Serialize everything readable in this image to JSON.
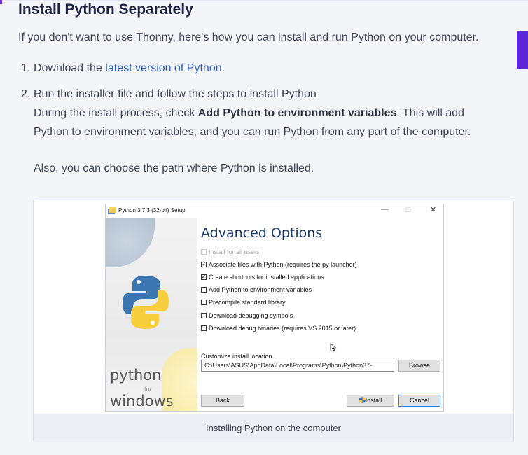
{
  "heading": "Install Python Separately",
  "intro": "If you don't want to use Thonny, here's how you can install and run Python on your computer.",
  "steps": [
    {
      "num": "1.",
      "prefix": "Download the ",
      "link": "latest version of Python",
      "suffix": "."
    },
    {
      "num": "2.",
      "line1": "Run the installer file and follow the steps to install Python",
      "line2_pre": "During the install process, check ",
      "line2_bold": "Add Python to environment variables",
      "line2_post": ". This will add",
      "line3": "Python to environment variables, and you can run Python from any part of the computer."
    }
  ],
  "also": "Also, you can choose the path where Python is installed.",
  "figure": {
    "caption": "Installing Python on the computer",
    "window": {
      "title": "Python 3.7.3 (32-bit) Setup",
      "minimize": "—",
      "maximize": "☐",
      "close": "✕",
      "heading": "Advanced Options",
      "brand_python": "python",
      "brand_for": "for",
      "brand_windows": "windows",
      "options": [
        {
          "label": "Install for all users",
          "checked": false,
          "disabled": true
        },
        {
          "label": "Associate files with Python (requires the py launcher)",
          "checked": true,
          "disabled": false
        },
        {
          "label": "Create shortcuts for installed applications",
          "checked": true,
          "disabled": false
        },
        {
          "label": "Add Python to environment variables",
          "checked": false,
          "disabled": false
        },
        {
          "label": "Precompile standard library",
          "checked": false,
          "disabled": false
        },
        {
          "label": "Download debugging symbols",
          "checked": false,
          "disabled": false
        },
        {
          "label": "Download debug binaries (requires VS 2015 or later)",
          "checked": false,
          "disabled": false
        }
      ],
      "location_label": "Customize install location",
      "location_value": "C:\\Users\\ASUS\\AppData\\Local\\Programs\\Python\\Python37-",
      "browse": "Browse",
      "back": "Back",
      "install": "Install",
      "cancel": "Cancel"
    }
  },
  "colors": {
    "accent": "#5b27d6",
    "link": "#2c5bb5",
    "heading": "#1f2344"
  }
}
